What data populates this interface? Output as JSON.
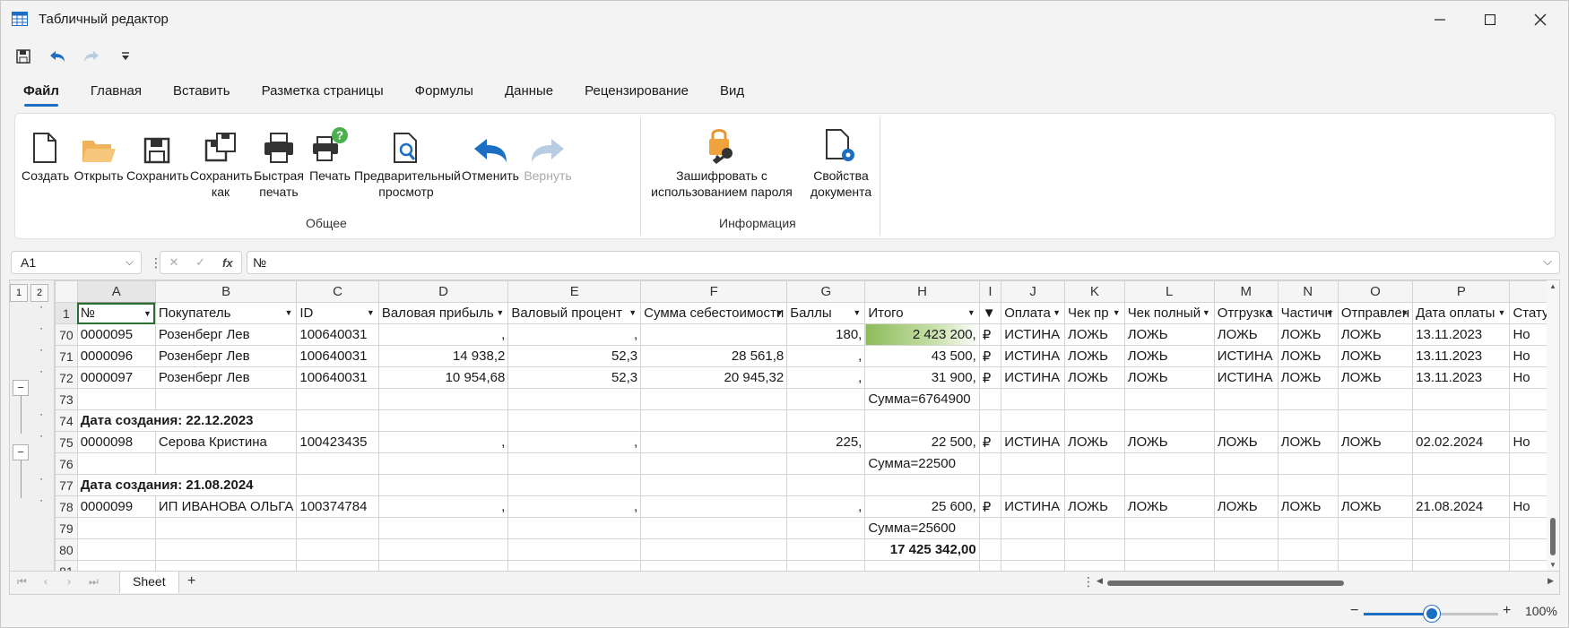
{
  "window": {
    "title": "Табличный редактор"
  },
  "tabs": [
    "Файл",
    "Главная",
    "Вставить",
    "Разметка страницы",
    "Формулы",
    "Данные",
    "Рецензирование",
    "Вид"
  ],
  "ribbon": {
    "general": {
      "label": "Общее",
      "buttons": {
        "new": "Создать",
        "open": "Открыть",
        "save": "Сохранить",
        "save_as_1": "Сохранить",
        "save_as_2": "как",
        "quick_print_1": "Быстрая",
        "quick_print_2": "печать",
        "print": "Печать",
        "preview_1": "Предварительный",
        "preview_2": "просмотр",
        "undo": "Отменить",
        "redo": "Вернуть"
      }
    },
    "info": {
      "label": "Информация",
      "buttons": {
        "encrypt_1": "Зашифровать с",
        "encrypt_2": "использованием пароля",
        "props_1": "Свойства",
        "props_2": "документа"
      }
    }
  },
  "formula_bar": {
    "name_box": "A1",
    "value": "№"
  },
  "outline": {
    "levels": [
      "1",
      "2"
    ]
  },
  "sheet": {
    "columns": [
      "A",
      "B",
      "C",
      "D",
      "E",
      "F",
      "G",
      "H",
      "I",
      "J",
      "K",
      "L",
      "M",
      "N",
      "O",
      "P",
      ""
    ],
    "header_row": {
      "num": "1",
      "cells": [
        "№",
        "Покупатель",
        "ID",
        "Валовая прибыль",
        "Валовый процент",
        "Сумма себестоимости",
        "Баллы",
        "Итого",
        "",
        "Оплата",
        "Чек пр",
        "Чек полный",
        "Отгрузка",
        "Частичн",
        "Отправлен",
        "Дата оплаты",
        "Статус"
      ]
    },
    "rows": [
      {
        "num": "70",
        "cells": [
          "0000095",
          "Розенберг Лев",
          "100640031",
          ",",
          ",",
          "",
          "180,",
          "2 423 200,",
          "₽",
          "ИСТИНА",
          "ЛОЖЬ",
          "ЛОЖЬ",
          "ЛОЖЬ",
          "ЛОЖЬ",
          "ЛОЖЬ",
          "13.11.2023",
          "Но"
        ]
      },
      {
        "num": "71",
        "cells": [
          "0000096",
          "Розенберг Лев",
          "100640031",
          "14 938,2",
          "52,3",
          "28 561,8",
          ",",
          "43 500,",
          "₽",
          "ИСТИНА",
          "ЛОЖЬ",
          "ЛОЖЬ",
          "ИСТИНА",
          "ЛОЖЬ",
          "ЛОЖЬ",
          "13.11.2023",
          "Но"
        ]
      },
      {
        "num": "72",
        "cells": [
          "0000097",
          "Розенберг Лев",
          "100640031",
          "10 954,68",
          "52,3",
          "20 945,32",
          ",",
          "31 900,",
          "₽",
          "ИСТИНА",
          "ЛОЖЬ",
          "ЛОЖЬ",
          "ИСТИНА",
          "ЛОЖЬ",
          "ЛОЖЬ",
          "13.11.2023",
          "Но"
        ]
      },
      {
        "num": "73",
        "cells": [
          "",
          "",
          "",
          "",
          "",
          "",
          "",
          "Сумма=6764900",
          "",
          "",
          "",
          "",
          "",
          "",
          "",
          "",
          ""
        ]
      },
      {
        "num": "74",
        "cells": [
          "Дата создания: 22.12.2023",
          "",
          "",
          "",
          "",
          "",
          "",
          "",
          "",
          "",
          "",
          "",
          "",
          "",
          "",
          "",
          ""
        ]
      },
      {
        "num": "75",
        "cells": [
          "0000098",
          "Серова Кристина",
          "100423435",
          ",",
          ",",
          "",
          "225,",
          "22 500,",
          "₽",
          "ИСТИНА",
          "ЛОЖЬ",
          "ЛОЖЬ",
          "ЛОЖЬ",
          "ЛОЖЬ",
          "ЛОЖЬ",
          "02.02.2024",
          "Но"
        ]
      },
      {
        "num": "76",
        "cells": [
          "",
          "",
          "",
          "",
          "",
          "",
          "",
          "Сумма=22500",
          "",
          "",
          "",
          "",
          "",
          "",
          "",
          "",
          ""
        ]
      },
      {
        "num": "77",
        "cells": [
          "Дата создания: 21.08.2024",
          "",
          "",
          "",
          "",
          "",
          "",
          "",
          "",
          "",
          "",
          "",
          "",
          "",
          "",
          "",
          ""
        ]
      },
      {
        "num": "78",
        "cells": [
          "0000099",
          "ИП ИВАНОВА ОЛЬГА",
          "100374784",
          ",",
          ",",
          "",
          ",",
          "25 600,",
          "₽",
          "ИСТИНА",
          "ЛОЖЬ",
          "ЛОЖЬ",
          "ЛОЖЬ",
          "ЛОЖЬ",
          "ЛОЖЬ",
          "21.08.2024",
          "Но"
        ]
      },
      {
        "num": "79",
        "cells": [
          "",
          "",
          "",
          "",
          "",
          "",
          "",
          "Сумма=25600",
          "",
          "",
          "",
          "",
          "",
          "",
          "",
          "",
          ""
        ]
      },
      {
        "num": "80",
        "cells": [
          "",
          "",
          "",
          "",
          "",
          "",
          "",
          "17 425 342,00",
          "",
          "",
          "",
          "",
          "",
          "",
          "",
          "",
          ""
        ]
      },
      {
        "num": "81",
        "cells": [
          "",
          "",
          "",
          "",
          "",
          "",
          "",
          "",
          "",
          "",
          "",
          "",
          "",
          "",
          "",
          "",
          ""
        ]
      }
    ],
    "databar_fraction_row70": 0.6
  },
  "sheet_tabs": [
    "Sheet"
  ],
  "add_sheet": "+",
  "status": {
    "zoom": "100%",
    "zoom_minus": "−",
    "zoom_plus": "+"
  },
  "colors": {
    "accent": "#1b6ec2",
    "databar": "#8dbb5a",
    "selection": "#2a6e2f"
  }
}
